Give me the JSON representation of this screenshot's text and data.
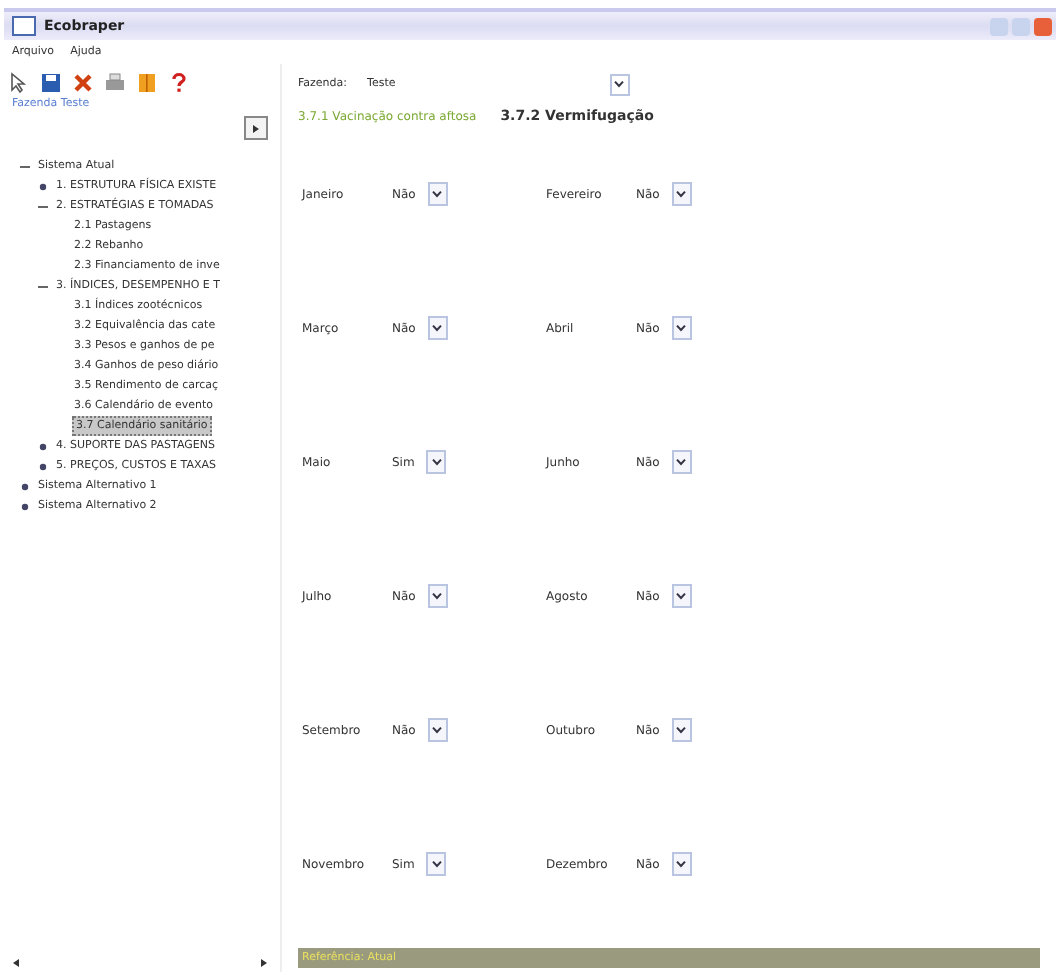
{
  "window": {
    "title": "Ecobraper"
  },
  "menu": [
    "Arquivo",
    "Ajuda"
  ],
  "toolbar": [
    {
      "kind": "cursor"
    },
    {
      "kind": "save"
    },
    {
      "kind": "delete"
    },
    {
      "kind": "print"
    },
    {
      "kind": "book"
    },
    {
      "kind": "help"
    }
  ],
  "sidebar": {
    "link": "Fazenda Teste",
    "tree": [
      {
        "label": "Sistema Atual",
        "expanded": true,
        "selected": false,
        "children": [
          {
            "label": "1. ESTRUTURA FÍSICA EXISTE",
            "expanded": false,
            "selected": false
          },
          {
            "label": "2. ESTRATÉGIAS E TOMADAS",
            "expanded": true,
            "selected": false,
            "children": [
              {
                "label": "2.1 Pastagens",
                "selected": false
              },
              {
                "label": "2.2 Rebanho",
                "selected": false
              },
              {
                "label": "2.3 Financiamento de inve",
                "selected": false
              }
            ]
          },
          {
            "label": "3. ÍNDICES, DESEMPENHO E T",
            "expanded": true,
            "selected": false,
            "children": [
              {
                "label": "3.1 Índices zootécnicos",
                "selected": false
              },
              {
                "label": "3.2 Equivalência das cate",
                "selected": false
              },
              {
                "label": "3.3 Pesos e ganhos de pe",
                "selected": false
              },
              {
                "label": "3.4 Ganhos de peso diário",
                "selected": false
              },
              {
                "label": "3.5 Rendimento de carcaç",
                "selected": false
              },
              {
                "label": "3.6 Calendário de evento",
                "selected": false
              },
              {
                "label": "3.7 Calendário sanitário",
                "selected": true
              }
            ]
          },
          {
            "label": "4. SUPORTE DAS PASTAGENS",
            "expanded": false,
            "selected": false
          },
          {
            "label": "5. PREÇOS, CUSTOS E TAXAS",
            "expanded": false,
            "selected": false
          }
        ]
      },
      {
        "label": "Sistema Alternativo 1",
        "expanded": false,
        "selected": false
      },
      {
        "label": "Sistema Alternativo 2",
        "expanded": false,
        "selected": false
      }
    ]
  },
  "farm": {
    "label": "Fazenda:",
    "value": "Teste"
  },
  "breadcrumbs": [
    {
      "label": "3.7.1 Vacinação contra aftosa",
      "selected": false
    },
    {
      "label": "3.7.2 Vermifugação",
      "selected": true
    }
  ],
  "months": [
    {
      "label": "Janeiro",
      "value": "Não"
    },
    {
      "label": "Fevereiro",
      "value": "Não"
    },
    {
      "label": "Março",
      "value": "Não"
    },
    {
      "label": "Abril",
      "value": "Não"
    },
    {
      "label": "Maio",
      "value": "Sim"
    },
    {
      "label": "Junho",
      "value": "Não"
    },
    {
      "label": "Julho",
      "value": "Não"
    },
    {
      "label": "Agosto",
      "value": "Não"
    },
    {
      "label": "Setembro",
      "value": "Não"
    },
    {
      "label": "Outubro",
      "value": "Não"
    },
    {
      "label": "Novembro",
      "value": "Sim"
    },
    {
      "label": "Dezembro",
      "value": "Não"
    }
  ],
  "status_bar": "Referência: Atual"
}
